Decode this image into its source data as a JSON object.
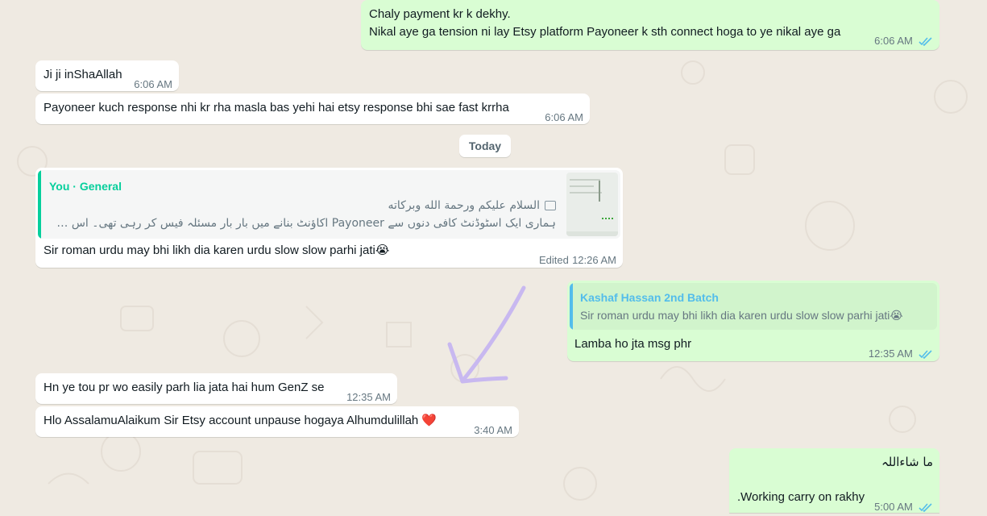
{
  "colors": {
    "wallpaper": "#efeae2",
    "incoming_bubble": "#ffffff",
    "outgoing_bubble": "#d9fdd3",
    "read_ticks": "#53bdeb",
    "quote_author_you": "#06cf9c",
    "quote_author_other": "#53bdeb",
    "annotation_arrow": "#c8b8f0"
  },
  "day_separator": "Today",
  "messages": {
    "m1": {
      "line1": "Chaly payment kr k dekhy.",
      "line2": "Nikal aye ga tension ni lay Etsy platform Payoneer k sth connect hoga to ye nikal aye ga",
      "time": "6:06 AM",
      "status": "read"
    },
    "m2": {
      "text": "Ji ji inShaAllah",
      "time": "6:06 AM"
    },
    "m3": {
      "text": "Payoneer kuch response nhi kr rha masla bas yehi hai etsy response bhi sae fast krrha",
      "time": "6:06 AM"
    },
    "m4": {
      "quote_author": "You · General",
      "quote_line1": "السلام علیکم ورحمة الله وبرکاته",
      "quote_line2": "ہماری ایک اسٹوڈنٹ کافی دنوں سے Payoneer اکاؤنٹ بنانے میں بار بار مسئلہ فیس کر رہی تھی۔ اس نے کئ..",
      "quote_icon": "image-icon",
      "text": "Sir roman urdu may bhi likh dia karen urdu slow slow parhi jati😭",
      "edited": "Edited",
      "time": "12:26 AM"
    },
    "m5": {
      "quote_author": "Kashaf Hassan 2nd Batch",
      "quote_text": "Sir roman urdu may bhi likh dia karen urdu slow slow parhi jati😭",
      "text": "Lamba ho jta msg phr",
      "time": "12:35 AM",
      "status": "read"
    },
    "m6": {
      "text": "Hn ye tou pr wo easily parh lia jata hai hum GenZ se",
      "time": "12:35 AM"
    },
    "m7": {
      "text": "Hlo AssalamuAlaikum Sir Etsy account unpause hogaya Alhumdulillah ❤️",
      "time": "3:40 AM"
    },
    "m8": {
      "line1": "ما شاءاللہ",
      "line2": "Working carry on rakhy.",
      "time": "5:00 AM",
      "status": "read"
    }
  }
}
